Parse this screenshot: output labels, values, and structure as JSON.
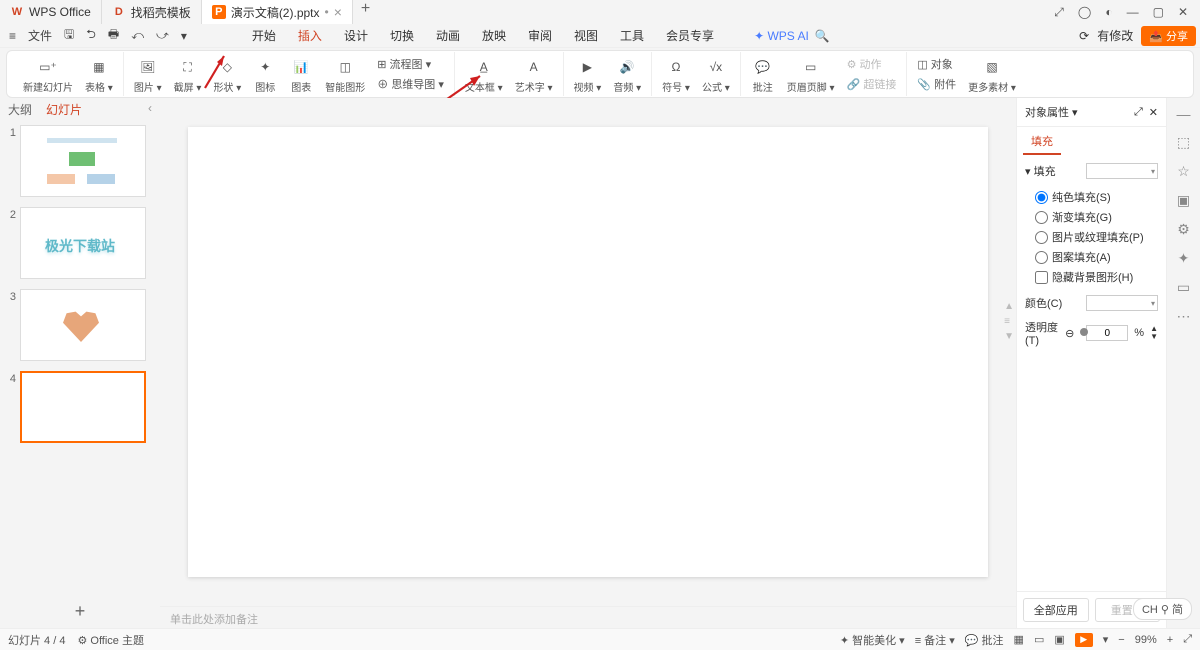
{
  "titlebar": {
    "tabs": [
      {
        "icon": "W",
        "icon_color": "#d14424",
        "label": "WPS Office"
      },
      {
        "icon": "D",
        "icon_color": "#d14424",
        "label": "找稻壳模板"
      },
      {
        "icon": "P",
        "icon_color": "#ff6a00",
        "label": "演示文稿(2).pptx",
        "dirty": "•"
      }
    ],
    "new_tab": "+",
    "winbtns": {
      "a": "⤢",
      "b": "◯",
      "c": "◐",
      "min": "—",
      "max": "▢",
      "close": "✕"
    }
  },
  "menu": {
    "file_icon": "≡",
    "file": "文件",
    "qat": [
      "🖫",
      "⮌",
      "🖶",
      "⤺",
      "⤻",
      "▾"
    ],
    "tabs": [
      "开始",
      "插入",
      "设计",
      "切换",
      "动画",
      "放映",
      "审阅",
      "视图",
      "工具",
      "会员专享"
    ],
    "active_tab": "插入",
    "ai": "WPS AI",
    "search": "🔍",
    "cloud": "⟳",
    "changes": "有修改",
    "share": "分享"
  },
  "ribbon": {
    "g1": {
      "new_slide": "新建幻灯片",
      "table": "表格"
    },
    "g2": {
      "pic": "图片",
      "screenshot": "截屏",
      "shape": "形状",
      "icon": "图标",
      "chart": "图表",
      "smart": "智能图形"
    },
    "g2b": {
      "flow": "流程图 ▾",
      "mind": "思维导图 ▾"
    },
    "g3": {
      "textbox": "文本框",
      "wordart": "艺术字"
    },
    "g4": {
      "video": "视频",
      "audio": "音频"
    },
    "g5": {
      "symbol": "符号",
      "formula": "公式"
    },
    "g6": {
      "comment": "批注",
      "hf": "页眉页脚"
    },
    "g6b": {
      "action": "动作",
      "link": "超链接"
    },
    "g7": {
      "object": "对象",
      "attach": "附件",
      "more": "更多素材"
    }
  },
  "slidepanel": {
    "tabs": {
      "outline": "大纲",
      "slides": "幻灯片"
    },
    "t2_text": "极光下载站",
    "add": "+"
  },
  "notes_placeholder": "单击此处添加备注",
  "prop": {
    "title": "对象属性 ▾",
    "tab": "填充",
    "section": "▾ 填充",
    "opts": {
      "solid": "纯色填充(S)",
      "gradient": "渐变填充(G)",
      "picture": "图片或纹理填充(P)",
      "pattern": "图案填充(A)",
      "hide": "隐藏背景图形(H)"
    },
    "color_label": "颜色(C)",
    "opacity_label": "透明度(T)",
    "opacity_val": "0",
    "opacity_unit": "%",
    "apply_all": "全部应用",
    "reset": "重置背"
  },
  "status": {
    "page": "幻灯片 4 / 4",
    "theme": "Office 主题",
    "beautify": "智能美化 ▾",
    "notes": "≡ 备注 ▾",
    "comment": "批注",
    "view_icons": [
      "▦",
      "▭",
      "▣"
    ],
    "play": "▶",
    "zoom": "99%",
    "fit": "⤢"
  },
  "lang": "CH ⚲ 简"
}
